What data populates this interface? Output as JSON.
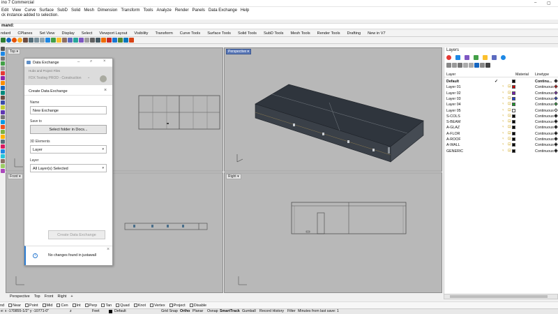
{
  "window": {
    "title": "ino 7 Commercial",
    "min": "–",
    "restore": "▢"
  },
  "menu": [
    "Edit",
    "View",
    "Curve",
    "Surface",
    "SubD",
    "Solid",
    "Mesh",
    "Dimension",
    "Transform",
    "Tools",
    "Analyze",
    "Render",
    "Panels",
    "Data Exchange",
    "Help"
  ],
  "command_history": "ck instance added to selection.",
  "command_prompt": "mand:",
  "toolbar_tabs": [
    "ndard",
    "CPlanes",
    "Set View",
    "Display",
    "Select",
    "Viewport Layout",
    "Visibility",
    "Transform",
    "Curve Tools",
    "Surface Tools",
    "Solid Tools",
    "SubD Tools",
    "Mesh Tools",
    "Render Tools",
    "Drafting",
    "New in V7"
  ],
  "viewports": {
    "top": {
      "label": "Top",
      "arrow": "▾"
    },
    "perspective": {
      "label": "Perspective",
      "arrow": "▾"
    },
    "front": {
      "label": "Front",
      "arrow": "▾"
    },
    "right": {
      "label": "Right",
      "arrow": "▾"
    }
  },
  "viewport_tabs": [
    "Perspective",
    "Top",
    "Front",
    "Right",
    "+"
  ],
  "dialog": {
    "title": "Data Exchange",
    "hub_label": "Hubs and Project Files",
    "hub_value": "FDX Testing PROD - Construction",
    "section_title": "Create Data Exchange",
    "name_label": "Name",
    "name_value": "New Exchange",
    "save_label": "Save to",
    "save_button": "Select folder in Docs...",
    "elements_label": "3D Elements",
    "elements_value": "Layer",
    "layer_label": "Layer",
    "layer_value": "All Layer(s) Selected",
    "create_button": "Create Data Exchange",
    "toast_text": "No changes found in justawall"
  },
  "layers_panel": {
    "title": "Layers",
    "col_layer": "Layer",
    "col_material": "Material",
    "col_linetype": "Linetype",
    "rows": [
      {
        "name": "Default",
        "swatch": "#000000",
        "linetype": "Continu...",
        "diamond": "#000000",
        "bold": true
      },
      {
        "name": "Layer 01",
        "swatch": "#cc0000",
        "linetype": "Continuous",
        "diamond": "#cc0000"
      },
      {
        "name": "Layer 02",
        "swatch": "#7a1fb0",
        "linetype": "Continuous",
        "diamond": "#7a1fb0"
      },
      {
        "name": "Layer 03",
        "swatch": "#1e3fd0",
        "linetype": "Continuous",
        "diamond": "#1e3fd0"
      },
      {
        "name": "Layer 04",
        "swatch": "#1a9a2a",
        "linetype": "Continuous",
        "diamond": "#1a9a2a"
      },
      {
        "name": "Layer 05",
        "swatch": "#ffffff",
        "linetype": "Continuous",
        "diamond": "#ffffff"
      },
      {
        "name": "S-COLS",
        "swatch": "#000000",
        "linetype": "Continuous",
        "diamond": "#000000"
      },
      {
        "name": "S-BEAM",
        "swatch": "#000000",
        "linetype": "Continuous",
        "diamond": "#000000"
      },
      {
        "name": "A-GLAZ",
        "swatch": "#000000",
        "linetype": "Continuous",
        "diamond": "#000000"
      },
      {
        "name": "A-FLOR",
        "swatch": "#000000",
        "linetype": "Continuous",
        "diamond": "#000000"
      },
      {
        "name": "A-ROOF",
        "swatch": "#000000",
        "linetype": "Continuous",
        "diamond": "#000000"
      },
      {
        "name": "A-WALL",
        "swatch": "#000000",
        "linetype": "Continuous",
        "diamond": "#000000"
      },
      {
        "name": "GENERIC",
        "swatch": "#000000",
        "linetype": "Continuous",
        "diamond": "#000000"
      }
    ]
  },
  "osnap": [
    "nd",
    "Near",
    "Point",
    "Mid",
    "Cen",
    "Int",
    "Perp",
    "Tan",
    "Quad",
    "Knot",
    "Vertex",
    "Project",
    "Disable"
  ],
  "status": {
    "coords": "e: x -170855-1/2\"   y -10771-0\"",
    "z": "z",
    "units": "Feet",
    "layer": "Default",
    "grid_snap": "Grid Snap",
    "ortho": "Ortho",
    "planar": "Planar",
    "osnap": "Osnap",
    "smarttrack": "SmartTrack",
    "gumball": "Gumball",
    "record": "Record History",
    "filter": "Filter",
    "minutes": "Minutes from last save: 1"
  }
}
